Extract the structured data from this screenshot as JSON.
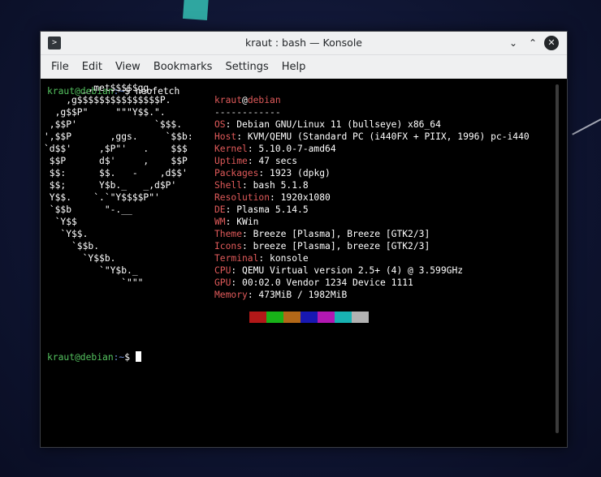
{
  "window": {
    "title": "kraut : bash — Konsole",
    "app_icon_glyph": ">",
    "controls": {
      "minimize": "⌄",
      "maximize": "⌃",
      "close": "✕"
    }
  },
  "menubar": {
    "items": [
      "File",
      "Edit",
      "View",
      "Bookmarks",
      "Settings",
      "Help"
    ]
  },
  "terminal": {
    "prompt_user_host": "kraut@debian",
    "prompt_path": ":~",
    "prompt_symbol": "$",
    "command": "neofetch",
    "logo_lines": [
      "",
      "       _,met$$$$$gg.",
      "    ,g$$$$$$$$$$$$$$$P.",
      "  ,g$$P\"     \"\"\"Y$$.\".",
      " ,$$P'              `$$$.",
      "',$$P       ,ggs.     `$$b:",
      "`d$$'     ,$P\"'   .    $$$",
      " $$P      d$'     ,    $$P",
      " $$:      $$.   -    ,d$$'",
      " $$;      Y$b._   _,d$P'",
      " Y$$.    `.`\"Y$$$$P\"'",
      " `$$b      \"-.__",
      "  `Y$$",
      "   `Y$$.",
      "     `$$b.",
      "       `Y$$b.",
      "          `\"Y$b._",
      "              `\"\"\""
    ],
    "info_header": {
      "user": "kraut",
      "at": "@",
      "host": "debian",
      "underline": "------------"
    },
    "info": [
      {
        "key": "OS",
        "value": "Debian GNU/Linux 11 (bullseye) x86_64"
      },
      {
        "key": "Host",
        "value": "KVM/QEMU (Standard PC (i440FX + PIIX, 1996) pc-i440"
      },
      {
        "key": "Kernel",
        "value": "5.10.0-7-amd64"
      },
      {
        "key": "Uptime",
        "value": "47 secs"
      },
      {
        "key": "Packages",
        "value": "1923 (dpkg)"
      },
      {
        "key": "Shell",
        "value": "bash 5.1.8"
      },
      {
        "key": "Resolution",
        "value": "1920x1080"
      },
      {
        "key": "DE",
        "value": "Plasma 5.14.5"
      },
      {
        "key": "WM",
        "value": "KWin"
      },
      {
        "key": "Theme",
        "value": "Breeze [Plasma], Breeze [GTK2/3]"
      },
      {
        "key": "Icons",
        "value": "breeze [Plasma], breeze [GTK2/3]"
      },
      {
        "key": "Terminal",
        "value": "konsole"
      },
      {
        "key": "CPU",
        "value": "QEMU Virtual version 2.5+ (4) @ 3.599GHz"
      },
      {
        "key": "GPU",
        "value": "00:02.0 Vendor 1234 Device 1111"
      },
      {
        "key": "Memory",
        "value": "473MiB / 1982MiB"
      }
    ],
    "palette": [
      "#000000",
      "#b21818",
      "#18b218",
      "#b26818",
      "#1818b2",
      "#b218b2",
      "#18b2b2",
      "#b2b2b2"
    ]
  },
  "colors": {
    "accent_red": "#e05a5a",
    "prompt_green": "#54c25f",
    "prompt_blue": "#6f8fd9",
    "titlebar_bg": "#eff0f1"
  }
}
